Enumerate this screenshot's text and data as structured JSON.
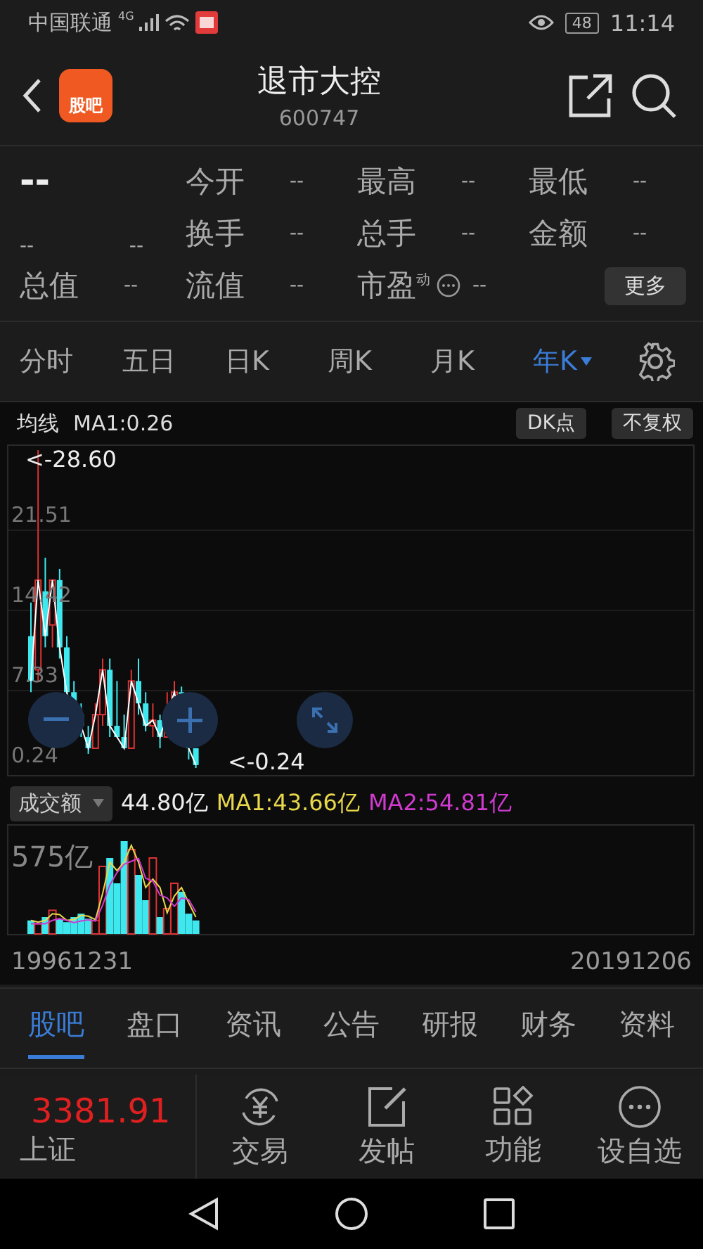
{
  "status_bar": {
    "carrier": "中国联通",
    "network": "4G",
    "battery": "48",
    "time": "11:14"
  },
  "header": {
    "app_badge": "股吧",
    "title": "退市大控",
    "code": "600747"
  },
  "quote": {
    "price": "--",
    "change": "--",
    "change_pct": "--",
    "fields": [
      {
        "label": "今开",
        "value": "--"
      },
      {
        "label": "最高",
        "value": "--"
      },
      {
        "label": "最低",
        "value": "--"
      },
      {
        "label": "换手",
        "value": "--"
      },
      {
        "label": "总手",
        "value": "--"
      },
      {
        "label": "金额",
        "value": "--"
      },
      {
        "label": "总值",
        "value": "--"
      },
      {
        "label": "流值",
        "value": "--"
      },
      {
        "label": "市盈$^{动}$",
        "value": "--",
        "info": true
      }
    ],
    "more_button": "更多"
  },
  "period_tabs": [
    {
      "label": "分时",
      "selected": false
    },
    {
      "label": "五日",
      "selected": false
    },
    {
      "label": "日K",
      "selected": false
    },
    {
      "label": "周K",
      "selected": false
    },
    {
      "label": "月K",
      "selected": false
    },
    {
      "label": "年K",
      "selected": true,
      "dropdown": true
    }
  ],
  "chart": {
    "indicator": "均线",
    "ma1": "MA1:0.26",
    "buttons": [
      "DK点",
      "不复权"
    ],
    "yticks": [
      "21.51",
      "14.42",
      "7.33",
      "0.24"
    ],
    "high_marker": "<-28.60",
    "low_marker": "<-0.24"
  },
  "volume": {
    "selector": "成交额",
    "value": "44.80亿",
    "ma1": "MA1:43.66亿",
    "ma2": "MA2:54.81亿",
    "max_label": "575亿",
    "start_date": "19961231",
    "end_date": "20191206"
  },
  "bottom_tabs": [
    {
      "label": "股吧",
      "selected": true
    },
    {
      "label": "盘口",
      "selected": false
    },
    {
      "label": "资讯",
      "selected": false
    },
    {
      "label": "公告",
      "selected": false
    },
    {
      "label": "研报",
      "selected": false
    },
    {
      "label": "财务",
      "selected": false
    },
    {
      "label": "资料",
      "selected": false
    }
  ],
  "index": {
    "value": "3381.91",
    "name": "上证"
  },
  "actions": [
    {
      "kind": "trade",
      "label": "交易"
    },
    {
      "kind": "post",
      "label": "发帖"
    },
    {
      "kind": "functions",
      "label": "功能"
    },
    {
      "kind": "watchlist",
      "label": "设自选"
    }
  ]
}
